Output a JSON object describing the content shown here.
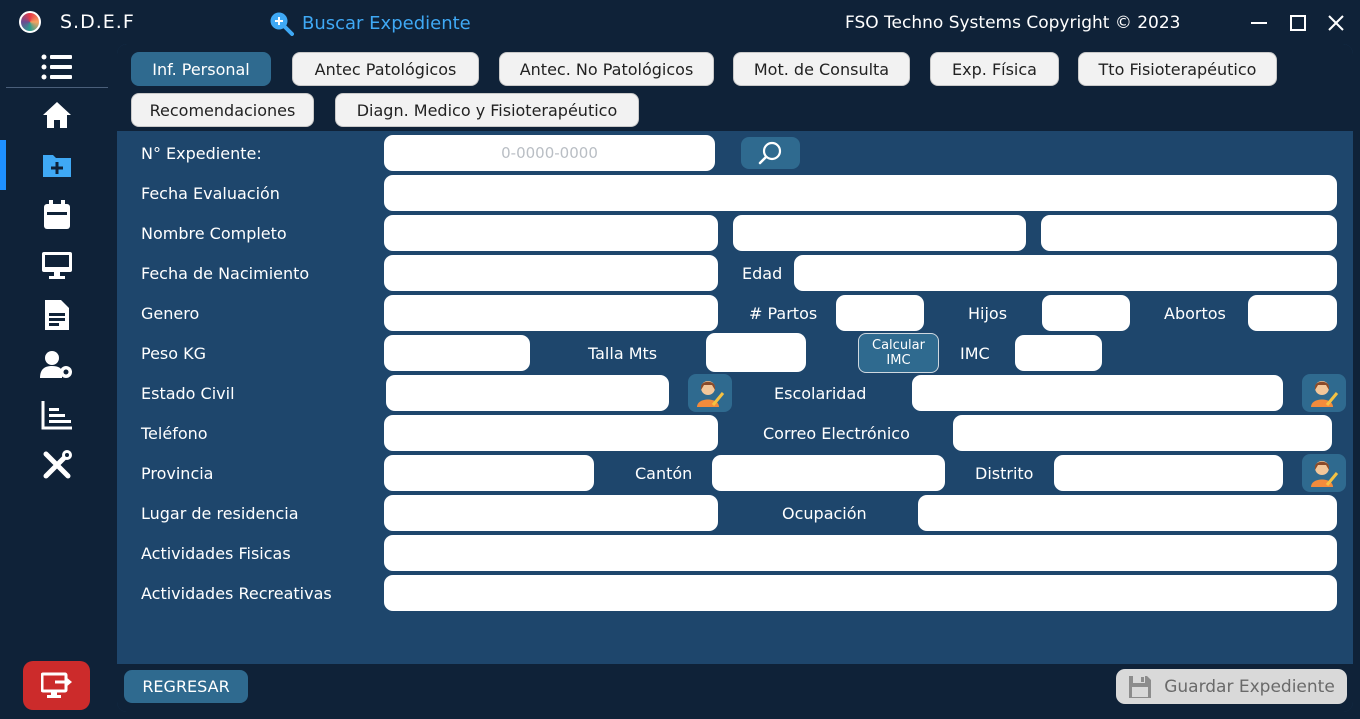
{
  "app": {
    "title": "S.D.E.F",
    "search_link": "Buscar Expediente",
    "copyright": "FSO Techno Systems Copyright ©  2023"
  },
  "tabs": [
    {
      "label": "Inf. Personal",
      "active": true
    },
    {
      "label": "Antec  Patológicos"
    },
    {
      "label": "Antec. No Patológicos"
    },
    {
      "label": "Mot. de Consulta"
    },
    {
      "label": "Exp.  Física"
    },
    {
      "label": "Tto Fisioterapéutico"
    },
    {
      "label": "Recomendaciones"
    },
    {
      "label": "Diagn. Medico y Fisioterapéutico"
    }
  ],
  "form": {
    "expediente_label": "N° Expediente:",
    "expediente_placeholder": "0-0000-0000",
    "fecha_evaluacion": "Fecha  Evaluación",
    "nombre": "Nombre Completo",
    "fecha_nacimiento": "Fecha de Nacimiento",
    "edad": "Edad",
    "genero": "Genero",
    "partos": "# Partos",
    "hijos": "Hijos",
    "abortos": "Abortos",
    "peso": "Peso KG",
    "talla": "Talla Mts",
    "calcular_imc_1": "Calcular",
    "calcular_imc_2": "IMC",
    "imc": "IMC",
    "estado_civil": "Estado Civil",
    "escolaridad": "Escolaridad",
    "telefono": "Teléfono",
    "correo": "Correo Electrónico",
    "provincia": "Provincia",
    "canton": "Cantón",
    "distrito": "Distrito",
    "lugar_residencia": "Lugar de residencia",
    "ocupacion": "Ocupación",
    "actividades_fisicas": "Actividades Fisicas",
    "actividades_recreativas": "Actividades Recreativas"
  },
  "footer": {
    "back": "REGRESAR",
    "save": "Guardar Expediente"
  },
  "sidebar": {
    "icons": [
      "menu-icon",
      "home-icon",
      "add-folder-icon",
      "calendar-icon",
      "monitor-icon",
      "document-icon",
      "user-settings-icon",
      "chart-icon",
      "tools-icon"
    ]
  },
  "colors": {
    "bg": "#0f2238",
    "panel": "#1e466c",
    "accent": "#2f6a8f",
    "link": "#3fa9f5",
    "exit": "#cc2b2b"
  }
}
